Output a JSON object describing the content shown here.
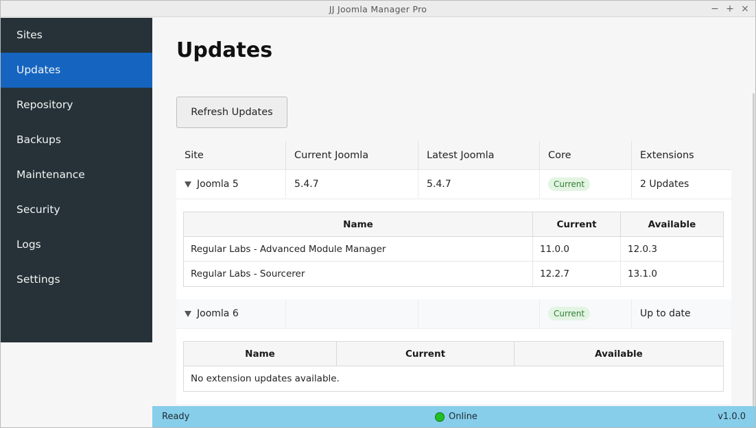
{
  "window": {
    "title": "JJ Joomla Manager Pro",
    "controls": {
      "minimize": "−",
      "maximize": "+",
      "close": "×"
    }
  },
  "sidebar": {
    "items": [
      {
        "label": "Sites",
        "active": false
      },
      {
        "label": "Updates",
        "active": true
      },
      {
        "label": "Repository",
        "active": false
      },
      {
        "label": "Backups",
        "active": false
      },
      {
        "label": "Maintenance",
        "active": false
      },
      {
        "label": "Security",
        "active": false
      },
      {
        "label": "Logs",
        "active": false
      },
      {
        "label": "Settings",
        "active": false
      }
    ]
  },
  "main": {
    "title": "Updates",
    "refresh_label": "Refresh Updates",
    "columns": [
      "Site",
      "Current Joomla",
      "Latest Joomla",
      "Core",
      "Extensions"
    ],
    "sites": [
      {
        "name": "Joomla 5",
        "current": "5.4.7",
        "latest": "5.4.7",
        "core": "Current",
        "extensions": "2 Updates",
        "ext_columns": [
          "Name",
          "Current",
          "Available"
        ],
        "ext_rows": [
          {
            "name": "Regular Labs - Advanced Module Manager",
            "current": "11.0.0",
            "available": "12.0.3"
          },
          {
            "name": "Regular Labs - Sourcerer",
            "current": "12.2.7",
            "available": "13.1.0"
          }
        ]
      },
      {
        "name": "Joomla 6",
        "current": "",
        "latest": "",
        "core": "Current",
        "extensions": "Up to date",
        "ext_columns": [
          "Name",
          "Current",
          "Available"
        ],
        "empty_message": "No extension updates available."
      }
    ]
  },
  "statusbar": {
    "left": "Ready",
    "center": "Online",
    "right": "v1.0.0"
  },
  "colors": {
    "sidebar_bg": "#263238",
    "sidebar_active": "#1565c0",
    "statusbar_bg": "#87ceeb",
    "badge_bg": "#e3f4e3",
    "badge_text": "#2e7d32",
    "online_dot": "#20c020"
  }
}
